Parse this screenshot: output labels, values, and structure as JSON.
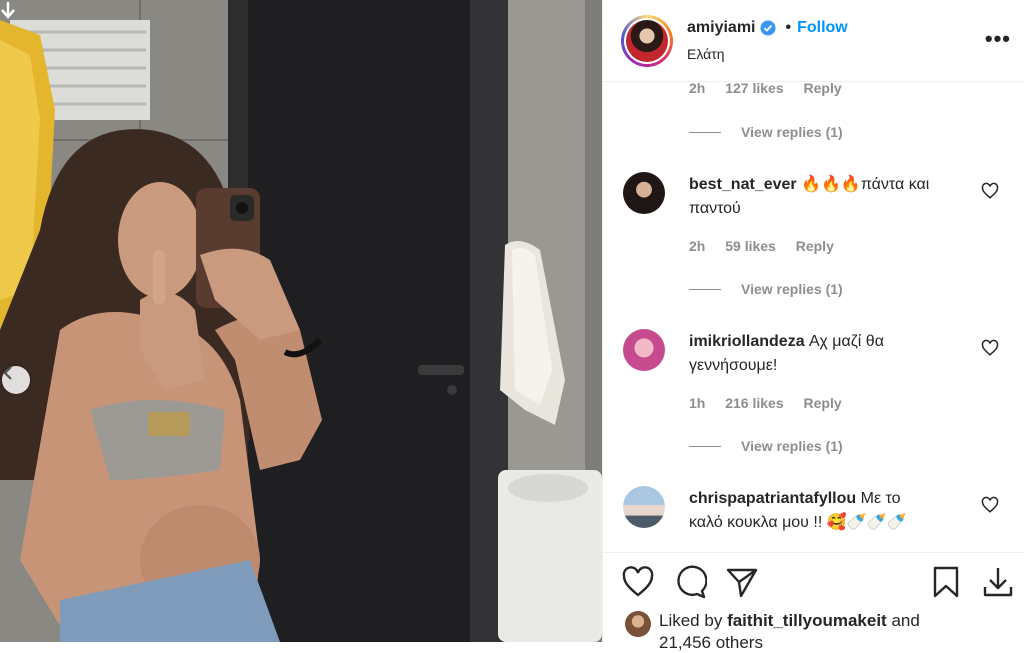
{
  "post": {
    "username": "amiyiami",
    "verified_icon": "verified-badge-icon",
    "separator": "•",
    "follow_label": "Follow",
    "location": "Ελάτη",
    "more_icon": "more-options-icon",
    "more_label": "•••"
  },
  "comments": {
    "partial_meta": {
      "time": "2h",
      "likes": "127 likes",
      "reply": "Reply"
    },
    "view_replies_label": "View replies (1)",
    "items": [
      {
        "username": "best_nat_ever",
        "text_line1": "🔥🔥🔥πάντα και",
        "text_line2": "παντού",
        "time": "2h",
        "likes": "59 likes",
        "reply": "Reply",
        "view_replies": "View replies (1)"
      },
      {
        "username": "imikriollandeza",
        "text_line1": "Αχ μαζί θα",
        "text_line2": "γεννήσουμε!",
        "time": "1h",
        "likes": "216 likes",
        "reply": "Reply",
        "view_replies": "View replies (1)"
      },
      {
        "username": "chrispapatriantafyllou",
        "text_line1": "Με το",
        "text_line2": "καλό κουκλα μου !! 🥰🍼🍼🍼"
      }
    ]
  },
  "actions": {
    "like_icon": "heart-icon",
    "comment_icon": "comment-icon",
    "share_icon": "send-icon",
    "save_icon": "bookmark-icon",
    "download_icon": "download-icon",
    "liked_by_prefix": "Liked by",
    "liked_by_user": "faithit_tillyoumakeit",
    "liked_by_suffix": "and",
    "others": "21,456 others"
  },
  "colors": {
    "link_blue": "#0095f6",
    "muted_text": "#8e8e8e",
    "primary_text": "#262626",
    "divider": "#efefef"
  }
}
